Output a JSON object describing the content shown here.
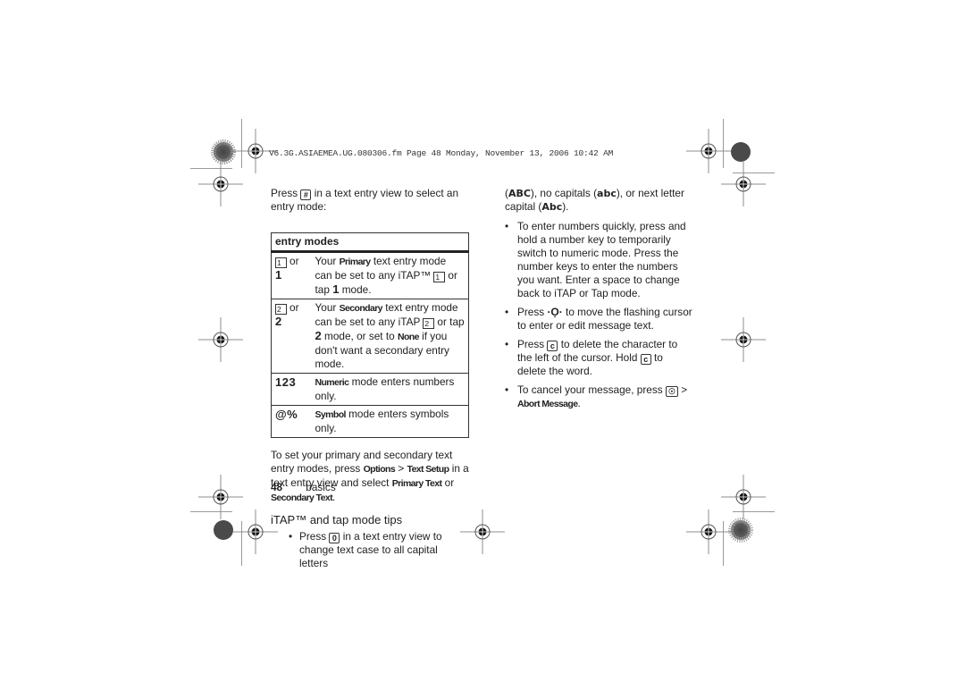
{
  "header": {
    "file_info": "V6.3G.ASIAEMEA.UG.080306.fm  Page 48  Monday, November 13, 2006  10:42 AM"
  },
  "left": {
    "intro_pre": "Press",
    "intro_key": "#",
    "intro_post": "in a text entry view to select an entry mode:",
    "table": {
      "title": "entry modes",
      "rows": [
        {
          "key_icon": "1",
          "key_or": "or",
          "key_alt": "1",
          "desc_pre": "Your",
          "desc_bold": "Primary",
          "desc_mid": "text entry mode can be set to any iTAP™",
          "desc_icon": "1",
          "desc_tap": "or tap",
          "desc_tapkey": "1",
          "desc_post": "mode."
        },
        {
          "key_icon": "2",
          "key_or": "or",
          "key_alt": "2",
          "desc_pre": "Your",
          "desc_bold": "Secondary",
          "desc_mid": "text entry mode can be set to any iTAP",
          "desc_icon": "2",
          "desc_tap": "or tap",
          "desc_tapkey": "2",
          "desc_post": "mode, or set to",
          "desc_none": "None",
          "desc_end": "if you don't want a secondary entry mode."
        },
        {
          "key": "123",
          "desc_bold": "Numeric",
          "desc": "mode enters numbers only."
        },
        {
          "key": "@%",
          "desc_bold": "Symbol",
          "desc": "mode enters symbols only."
        }
      ]
    },
    "setup_para": {
      "t1": "To set your primary and secondary text entry modes, press",
      "options": "Options",
      "gt": ">",
      "text_setup": "Text Setup",
      "t2": "in a text entry view and select",
      "primary_text": "Primary Text",
      "or": "or",
      "secondary_text": "Secondary Text",
      "end": "."
    },
    "subheading": "iTAP™ and tap mode tips",
    "bullet1": {
      "pre": "Press",
      "key": "0",
      "post": "in a text entry view to change text case to all capital letters"
    }
  },
  "right": {
    "cont_abc_all": "ABC",
    "cont_t1": "), no capitals (",
    "cont_abc_none": "abc",
    "cont_t2": "), or next letter capital (",
    "cont_abc_next": "Abc",
    "cont_t3": ").",
    "bullets": [
      {
        "text": "To enter numbers quickly, press and hold a number key to temporarily switch to numeric mode. Press the number keys to enter the numbers you want. Enter a space to change back to iTAP or Tap mode."
      },
      {
        "pre": "Press",
        "icon": "·Ọ·",
        "post": "to move the flashing cursor to enter or edit message text."
      },
      {
        "pre": "Press",
        "key": "c",
        "mid": "to delete the character to the left of the cursor. Hold",
        "key2": "c",
        "post": "to delete the word."
      },
      {
        "pre": "To cancel your message, press",
        "key": "☉",
        "gt": ">",
        "menu": "Abort Message",
        "end": "."
      }
    ]
  },
  "footer": {
    "page_number": "48",
    "section": "basics"
  }
}
